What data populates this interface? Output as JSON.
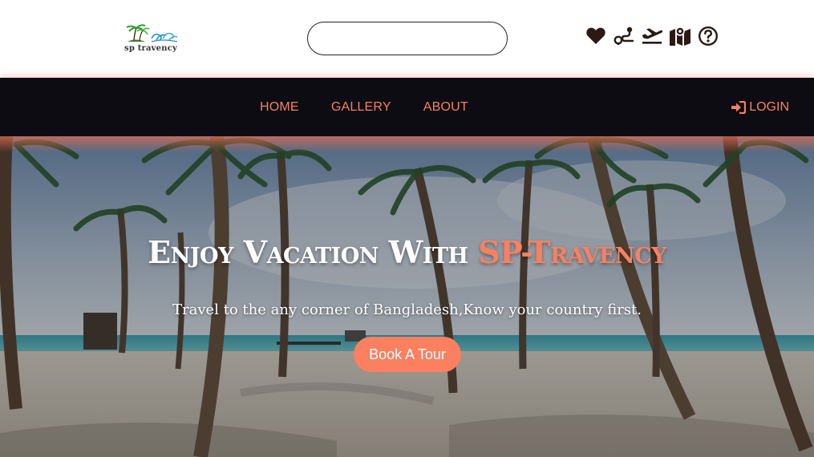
{
  "header": {
    "logo_text": "sp travency",
    "search": {
      "value": "",
      "placeholder": ""
    },
    "icons": [
      "heart-icon",
      "route-icon",
      "plane-departure-icon",
      "map-icon",
      "question-circle-icon"
    ]
  },
  "nav": {
    "links": [
      "HOME",
      "GALLERY",
      "ABOUT"
    ],
    "login_label": "LOGIN"
  },
  "hero": {
    "title_main": "Enjoy Vacation With ",
    "title_accent": "SP-Travency",
    "subtitle": "Travel to the any corner of Bangladesh,Know your country first.",
    "button_label": "Book A Tour"
  },
  "colors": {
    "accent": "#fa8060",
    "navbar_bg": "#0c0c12",
    "icon_color": "#2b1a14"
  }
}
